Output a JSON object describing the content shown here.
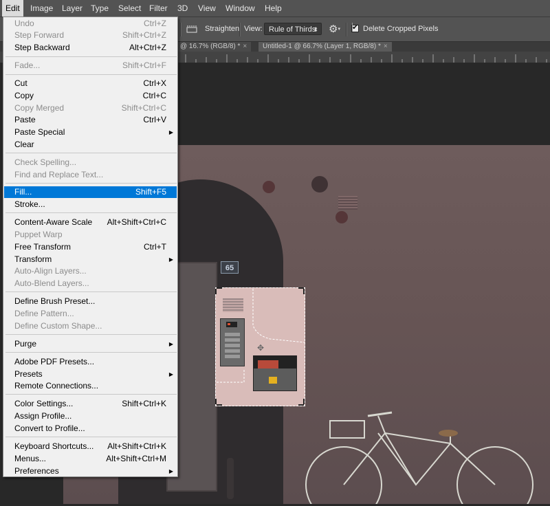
{
  "menubar": {
    "items": [
      "Edit",
      "Image",
      "Layer",
      "Type",
      "Select",
      "Filter",
      "3D",
      "View",
      "Window",
      "Help"
    ],
    "active": "Edit"
  },
  "options": {
    "straighten": "Straighten",
    "view_label": "View:",
    "view_value": "Rule of Thirds",
    "delete_cropped": "Delete Cropped Pixels",
    "delete_cropped_checked": true
  },
  "tabs": [
    {
      "label": "@ 16.7% (RGB/8) *"
    },
    {
      "label": "Untitled-1 @ 66.7% (Layer 1, RGB/8) *"
    }
  ],
  "canvas": {
    "house_number": "65"
  },
  "edit_menu": [
    {
      "label": "Undo",
      "shortcut": "Ctrl+Z",
      "disabled": true
    },
    {
      "label": "Step Forward",
      "shortcut": "Shift+Ctrl+Z",
      "disabled": true
    },
    {
      "label": "Step Backward",
      "shortcut": "Alt+Ctrl+Z",
      "disabled": false
    },
    {
      "label": "Fade...",
      "shortcut": "Shift+Ctrl+F",
      "disabled": true
    },
    {
      "label": "Cut",
      "shortcut": "Ctrl+X",
      "disabled": false
    },
    {
      "label": "Copy",
      "shortcut": "Ctrl+C",
      "disabled": false
    },
    {
      "label": "Copy Merged",
      "shortcut": "Shift+Ctrl+C",
      "disabled": true
    },
    {
      "label": "Paste",
      "shortcut": "Ctrl+V",
      "disabled": false
    },
    {
      "label": "Paste Special",
      "shortcut": "",
      "disabled": false,
      "submenu": true
    },
    {
      "label": "Clear",
      "shortcut": "",
      "disabled": false
    },
    {
      "label": "Check Spelling...",
      "shortcut": "",
      "disabled": true
    },
    {
      "label": "Find and Replace Text...",
      "shortcut": "",
      "disabled": true
    },
    {
      "label": "Fill...",
      "shortcut": "Shift+F5",
      "disabled": false,
      "highlighted": true
    },
    {
      "label": "Stroke...",
      "shortcut": "",
      "disabled": false
    },
    {
      "label": "Content-Aware Scale",
      "shortcut": "Alt+Shift+Ctrl+C",
      "disabled": false
    },
    {
      "label": "Puppet Warp",
      "shortcut": "",
      "disabled": true
    },
    {
      "label": "Free Transform",
      "shortcut": "Ctrl+T",
      "disabled": false
    },
    {
      "label": "Transform",
      "shortcut": "",
      "disabled": false,
      "submenu": true
    },
    {
      "label": "Auto-Align Layers...",
      "shortcut": "",
      "disabled": true
    },
    {
      "label": "Auto-Blend Layers...",
      "shortcut": "",
      "disabled": true
    },
    {
      "label": "Define Brush Preset...",
      "shortcut": "",
      "disabled": false
    },
    {
      "label": "Define Pattern...",
      "shortcut": "",
      "disabled": true
    },
    {
      "label": "Define Custom Shape...",
      "shortcut": "",
      "disabled": true
    },
    {
      "label": "Purge",
      "shortcut": "",
      "disabled": false,
      "submenu": true
    },
    {
      "label": "Adobe PDF Presets...",
      "shortcut": "",
      "disabled": false
    },
    {
      "label": "Presets",
      "shortcut": "",
      "disabled": false,
      "submenu": true
    },
    {
      "label": "Remote Connections...",
      "shortcut": "",
      "disabled": false
    },
    {
      "label": "Color Settings...",
      "shortcut": "Shift+Ctrl+K",
      "disabled": false
    },
    {
      "label": "Assign Profile...",
      "shortcut": "",
      "disabled": false
    },
    {
      "label": "Convert to Profile...",
      "shortcut": "",
      "disabled": false
    },
    {
      "label": "Keyboard Shortcuts...",
      "shortcut": "Alt+Shift+Ctrl+K",
      "disabled": false
    },
    {
      "label": "Menus...",
      "shortcut": "Alt+Shift+Ctrl+M",
      "disabled": false
    },
    {
      "label": "Preferences",
      "shortcut": "",
      "disabled": false,
      "submenu": true
    }
  ],
  "colors": {
    "highlight": "#0078d7",
    "menubar": "#535353",
    "menu_bg": "#f0f0f0"
  }
}
